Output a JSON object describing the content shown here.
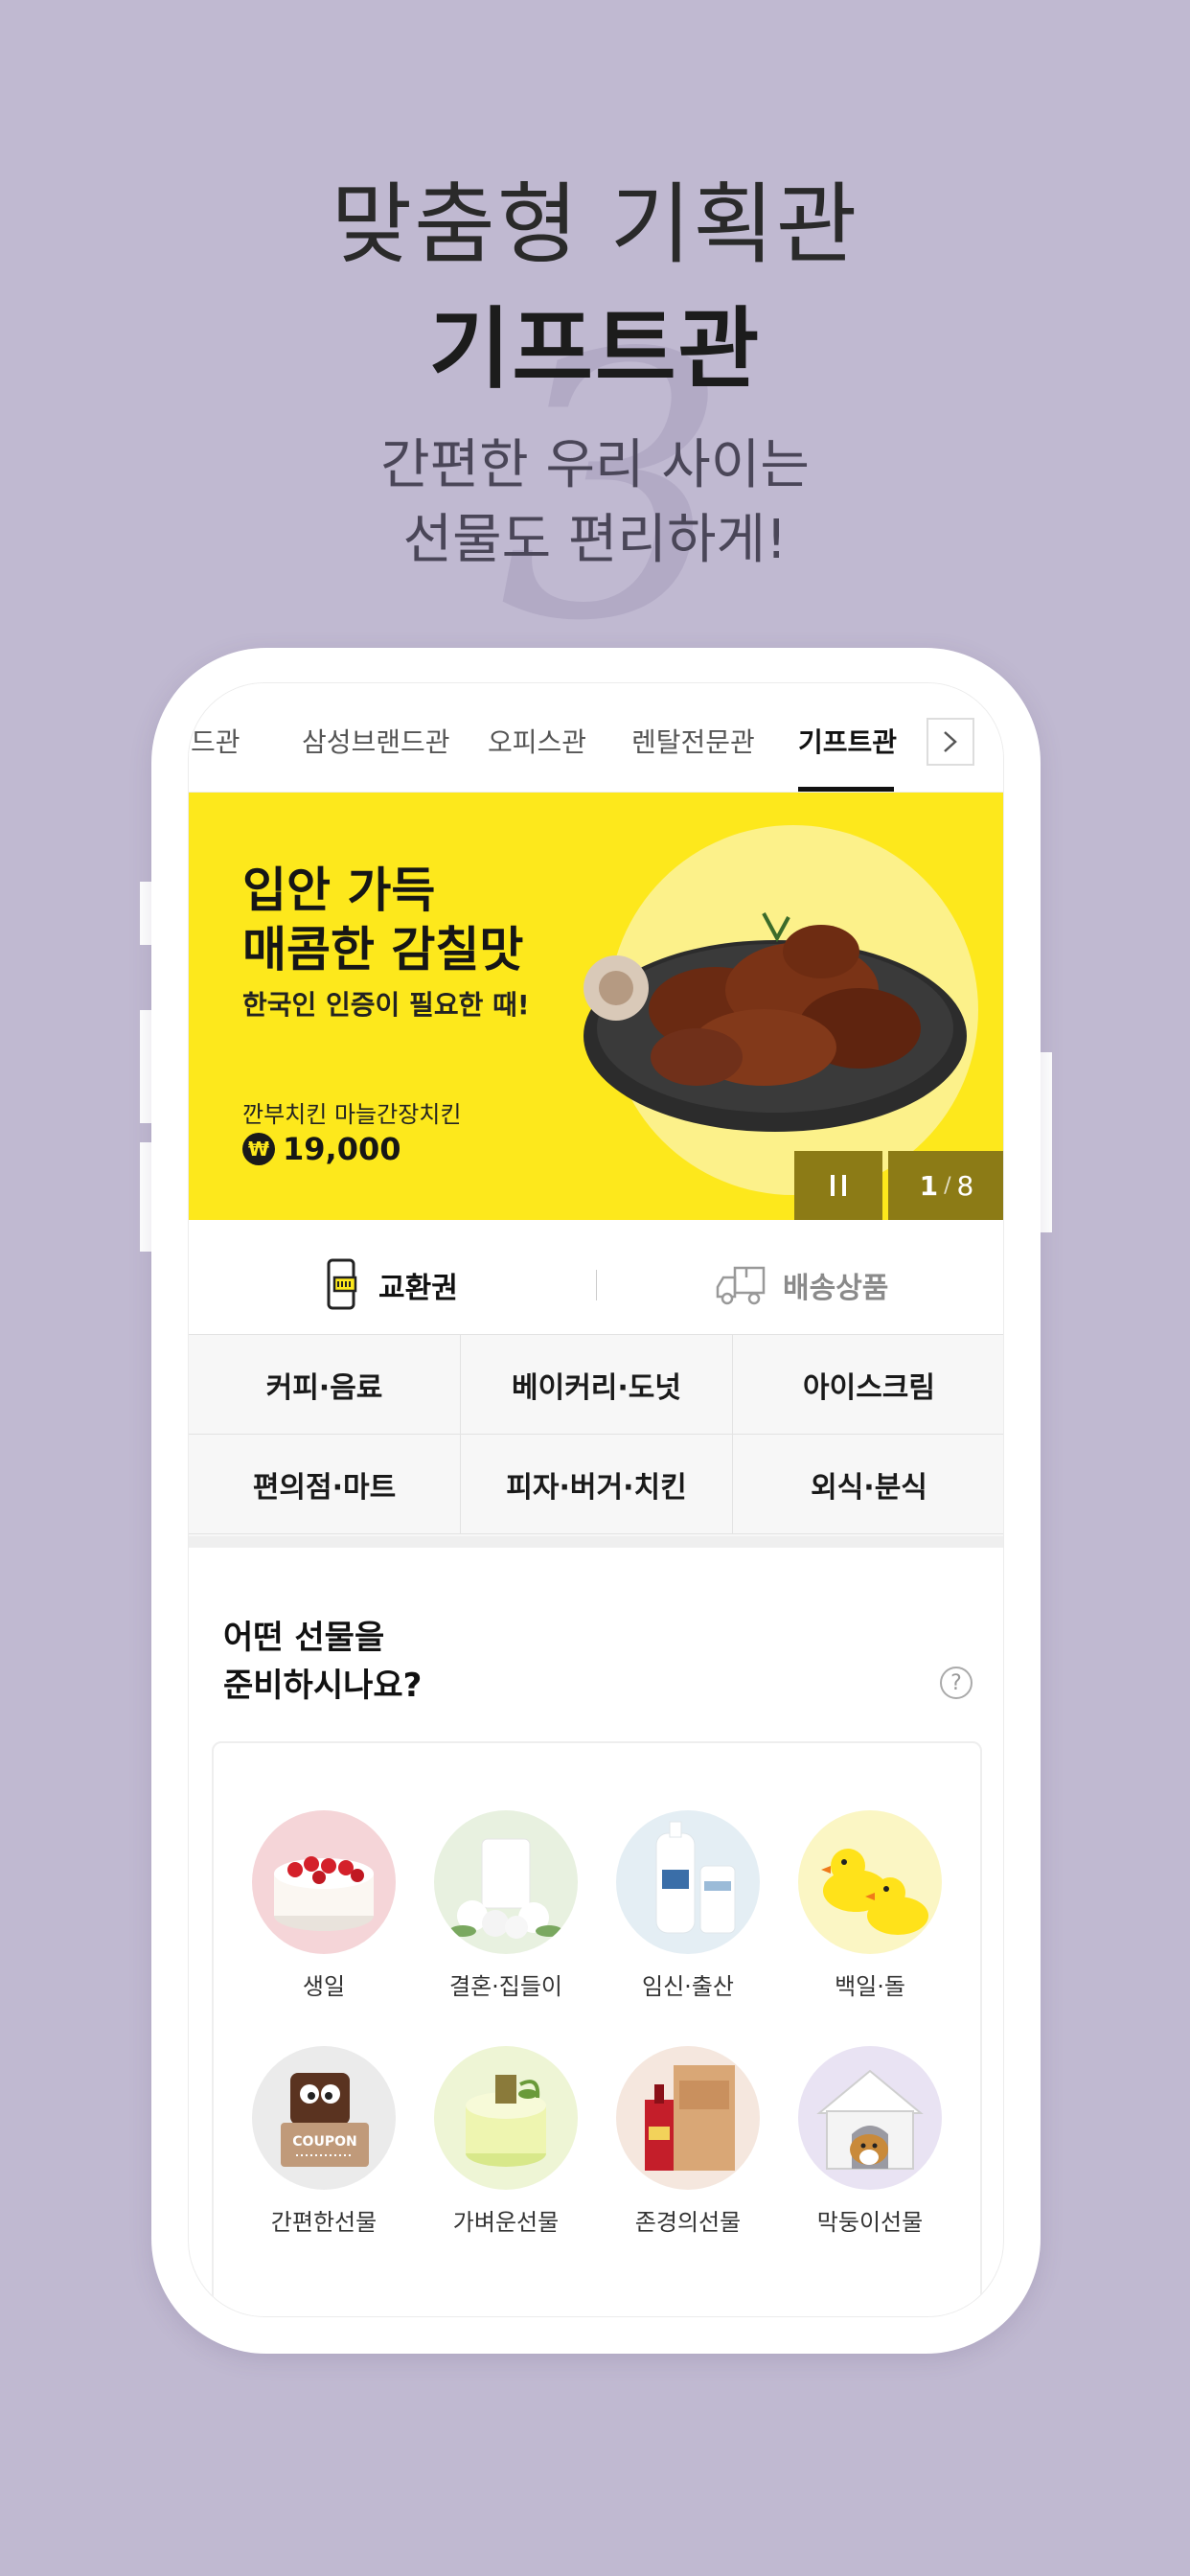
{
  "hero": {
    "line1": "맞춤형 기획관",
    "line2": "기프트관",
    "sub1": "간편한 우리 사이는",
    "sub2": "선물도 편리하게!",
    "deco_number": "3"
  },
  "tabs": [
    {
      "label": "드관"
    },
    {
      "label": "삼성브랜드관"
    },
    {
      "label": "오피스관"
    },
    {
      "label": "렌탈전문관"
    },
    {
      "label": "기프트관",
      "active": true
    }
  ],
  "banner": {
    "title1": "입안 가득",
    "title2": "매콤한 감칠맛",
    "desc": "한국인 인증이 필요한 때!",
    "product": "깐부치킨 마늘간장치킨",
    "currency": "₩",
    "price": "19,000",
    "page_current": "1",
    "page_sep": "/",
    "page_total": "8",
    "bg_color": "#fde81c"
  },
  "type_tabs": {
    "coupon": "교환권",
    "delivery": "배송상품"
  },
  "categories": [
    "커피·음료",
    "베이커리·도넛",
    "아이스크림",
    "편의점·마트",
    "피자·버거·치킨",
    "외식·분식"
  ],
  "gift_section": {
    "title1": "어떤 선물을",
    "title2": "준비하시나요?",
    "help": "?",
    "items": [
      {
        "label": "생일",
        "icon": "cake-icon"
      },
      {
        "label": "결혼·집들이",
        "icon": "candle-flowers-icon"
      },
      {
        "label": "임신·출산",
        "icon": "baby-lotion-icon"
      },
      {
        "label": "백일·돌",
        "icon": "rubber-duck-icon"
      },
      {
        "label": "간편한선물",
        "icon": "coupon-chocolate-icon"
      },
      {
        "label": "가벼운선물",
        "icon": "mini-cake-icon"
      },
      {
        "label": "존경의선물",
        "icon": "ginseng-box-icon"
      },
      {
        "label": "막둥이선물",
        "icon": "dog-house-icon"
      }
    ],
    "coupon_text": "COUPON"
  }
}
